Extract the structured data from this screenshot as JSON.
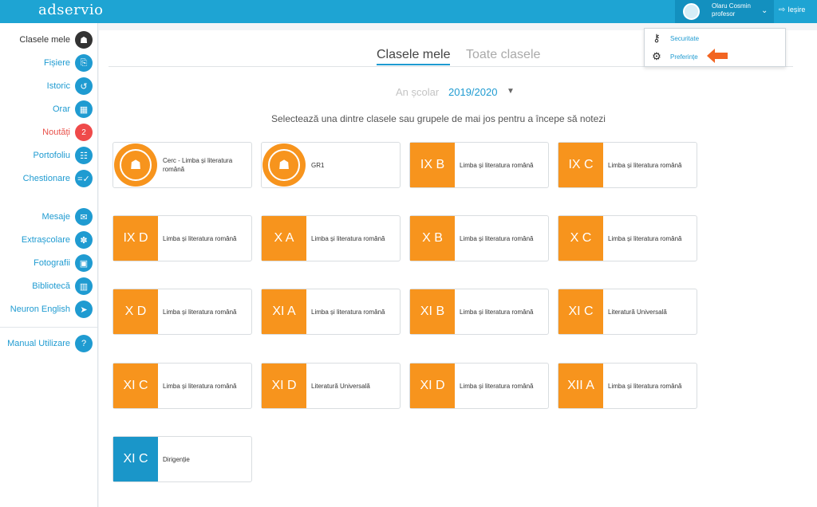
{
  "header": {
    "logo": "adservio",
    "user_name": "Olaru Cosmin",
    "user_role": "profesor",
    "logout_label": "Ieșire"
  },
  "sidebar": {
    "items": [
      {
        "label": "Clasele mele",
        "icon": "students-icon",
        "symbol": "☗"
      },
      {
        "label": "Fișiere",
        "icon": "paperclip-icon",
        "symbol": "⎘"
      },
      {
        "label": "Istoric",
        "icon": "history-icon",
        "symbol": "↺"
      },
      {
        "label": "Orar",
        "icon": "calendar-icon",
        "symbol": "▦"
      },
      {
        "label": "Noutăți",
        "icon": "notification-badge",
        "symbol": "2"
      },
      {
        "label": "Portofoliu",
        "icon": "portfolio-icon",
        "symbol": "☷"
      },
      {
        "label": "Chestionare",
        "icon": "questionnaire-icon",
        "symbol": "=✓"
      },
      {
        "label": "Mesaje",
        "icon": "envelope-icon",
        "symbol": "✉"
      },
      {
        "label": "Extrașcolare",
        "icon": "activities-icon",
        "symbol": "✽"
      },
      {
        "label": "Fotografii",
        "icon": "photos-icon",
        "symbol": "▣"
      },
      {
        "label": "Bibliotecă",
        "icon": "library-icon",
        "symbol": "▥"
      },
      {
        "label": "Neuron English",
        "icon": "paper-plane-icon",
        "symbol": "➤"
      },
      {
        "label": "Manual Utilizare",
        "icon": "help-icon",
        "symbol": "?"
      }
    ]
  },
  "tabs": {
    "active": "Clasele mele",
    "inactive": "Toate clasele"
  },
  "school_year": {
    "label": "An școlar",
    "value": "2019/2020"
  },
  "instruction": "Selectează una dintre clasele sau grupele de mai jos pentru a începe să notezi",
  "classes": [
    {
      "badge": "",
      "type": "group",
      "subject": "Cerc - Limba și literatura română"
    },
    {
      "badge": "",
      "type": "group",
      "subject": "GR1"
    },
    {
      "badge": "IX B",
      "type": "class",
      "subject": "Limba și literatura română"
    },
    {
      "badge": "IX C",
      "type": "class",
      "subject": "Limba și literatura română"
    },
    {
      "badge": "IX D",
      "type": "class",
      "subject": "Limba și literatura română"
    },
    {
      "badge": "X A",
      "type": "class",
      "subject": "Limba și literatura română"
    },
    {
      "badge": "X B",
      "type": "class",
      "subject": "Limba și literatura română"
    },
    {
      "badge": "X C",
      "type": "class",
      "subject": "Limba și literatura română"
    },
    {
      "badge": "X D",
      "type": "class",
      "subject": "Limba și literatura română"
    },
    {
      "badge": "XI A",
      "type": "class",
      "subject": "Limba și literatura română"
    },
    {
      "badge": "XI B",
      "type": "class",
      "subject": "Limba și literatura română"
    },
    {
      "badge": "XI C",
      "type": "class",
      "subject": "Literatură Universală"
    },
    {
      "badge": "XI C",
      "type": "class",
      "subject": "Limba și literatura română"
    },
    {
      "badge": "XI D",
      "type": "class",
      "subject": "Literatură Universală"
    },
    {
      "badge": "XI D",
      "type": "class",
      "subject": "Limba și literatura română"
    },
    {
      "badge": "XII A",
      "type": "class",
      "subject": "Limba și literatura română"
    },
    {
      "badge": "XI C",
      "type": "homeroom",
      "subject": "Dirigenție"
    }
  ],
  "dropdown": {
    "items": [
      {
        "label": "Securitate",
        "icon": "keys-icon"
      },
      {
        "label": "Preferințe",
        "icon": "gears-icon"
      }
    ]
  },
  "colors": {
    "accent": "#1ea4d3",
    "badge_orange": "#f7941d",
    "badge_blue": "#1a96c9",
    "arrow_orange": "#f26522",
    "notification_red": "#ef4a4a"
  }
}
